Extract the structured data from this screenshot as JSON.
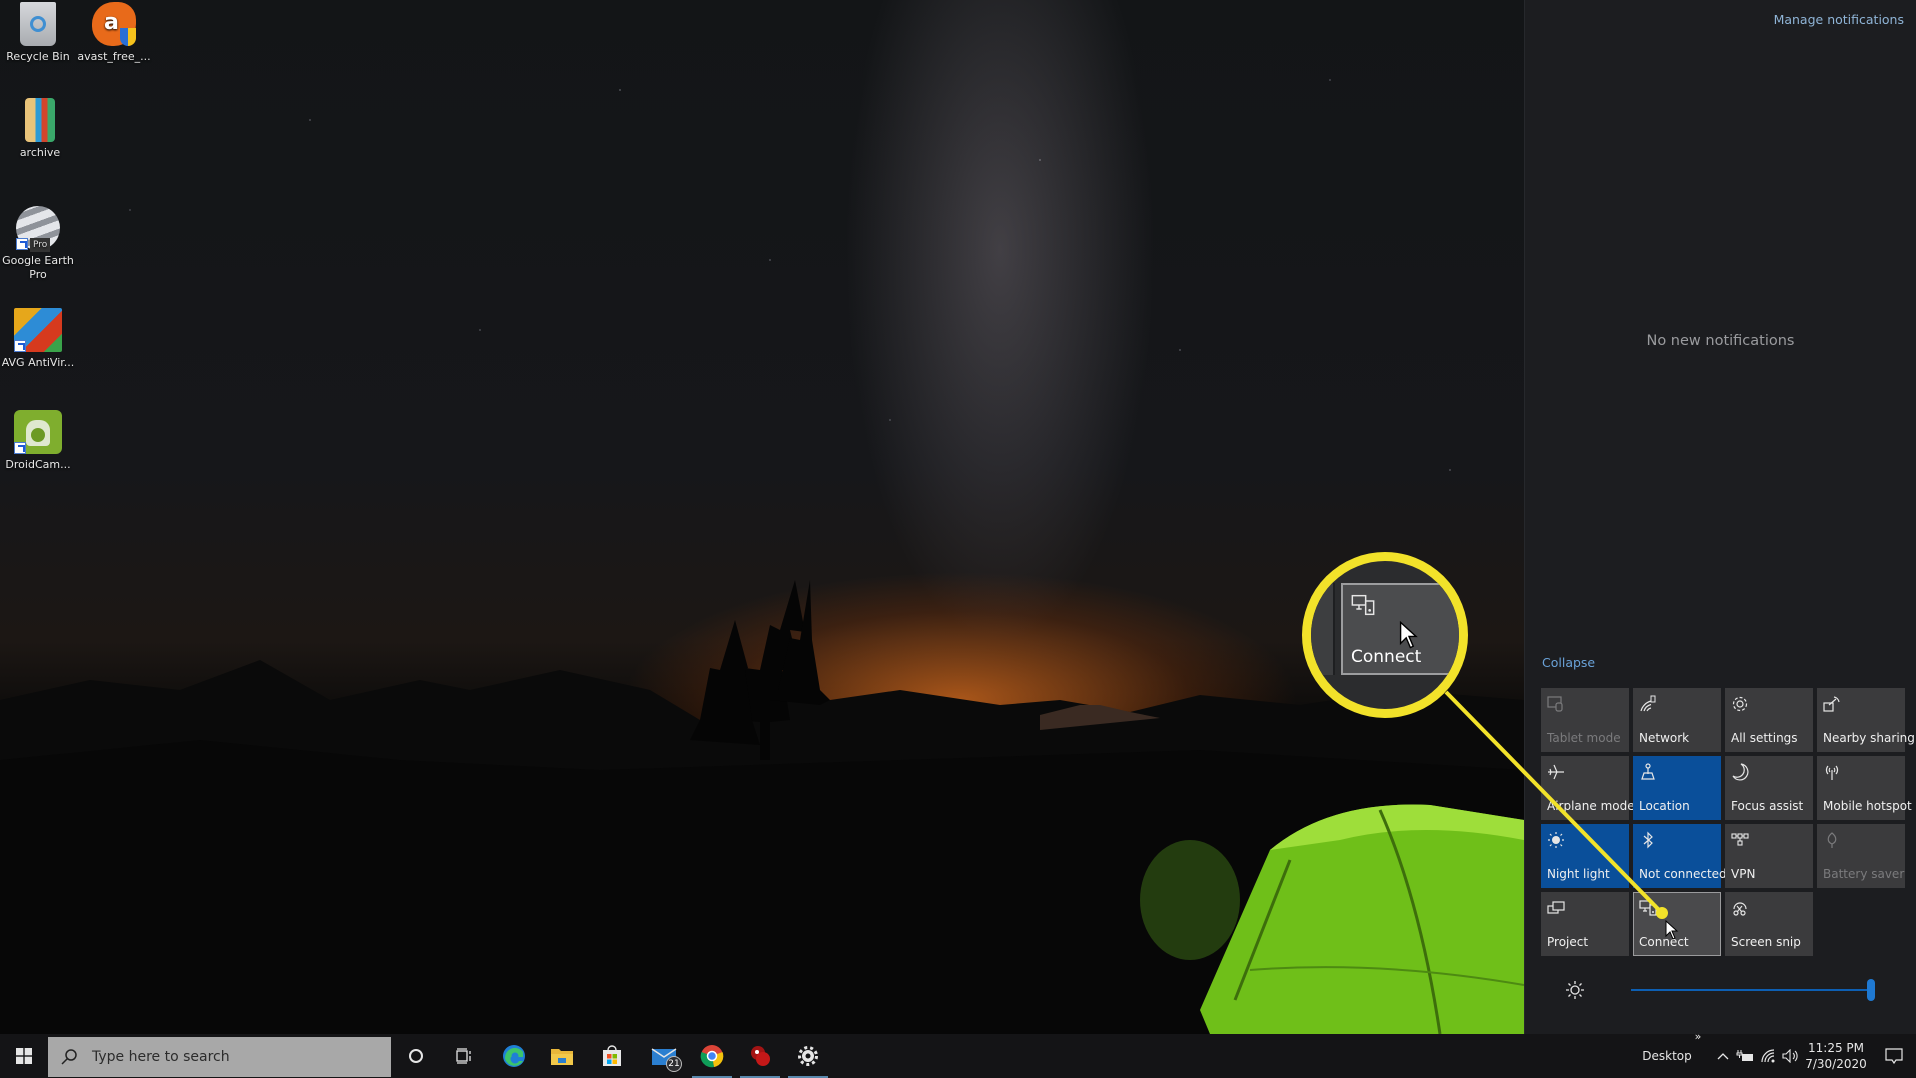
{
  "desktop": {
    "icons": [
      {
        "label": "Recycle Bin",
        "icon": "recycle-bin-icon"
      },
      {
        "label": "avast_free_...",
        "icon": "avast-icon"
      },
      {
        "label": "archive",
        "icon": "archive-folder-icon"
      },
      {
        "label": "Google Earth Pro",
        "icon": "google-earth-icon",
        "badge": "Pro"
      },
      {
        "label": "AVG AntiVir...",
        "icon": "avg-antivirus-icon"
      },
      {
        "label": "DroidCam...",
        "icon": "droidcam-icon"
      }
    ]
  },
  "action_center": {
    "manage_notifications": "Manage notifications",
    "empty_message": "No new notifications",
    "collapse_label": "Collapse",
    "tiles": [
      {
        "label": "Tablet mode",
        "icon": "tablet-mode-icon",
        "state": "disabled"
      },
      {
        "label": "Network",
        "icon": "network-icon",
        "state": "off"
      },
      {
        "label": "All settings",
        "icon": "gear-icon",
        "state": "off"
      },
      {
        "label": "Nearby sharing",
        "icon": "nearby-sharing-icon",
        "state": "off"
      },
      {
        "label": "Airplane mode",
        "icon": "airplane-icon",
        "state": "off"
      },
      {
        "label": "Location",
        "icon": "location-icon",
        "state": "on"
      },
      {
        "label": "Focus assist",
        "icon": "moon-icon",
        "state": "off"
      },
      {
        "label": "Mobile hotspot",
        "icon": "hotspot-icon",
        "state": "off"
      },
      {
        "label": "Night light",
        "icon": "night-light-icon",
        "state": "on"
      },
      {
        "label": "Not connected",
        "icon": "bluetooth-icon",
        "state": "on"
      },
      {
        "label": "VPN",
        "icon": "vpn-icon",
        "state": "off"
      },
      {
        "label": "Battery saver",
        "icon": "battery-saver-icon",
        "state": "disabled"
      },
      {
        "label": "Project",
        "icon": "project-icon",
        "state": "off"
      },
      {
        "label": "Connect",
        "icon": "connect-icon",
        "state": "hover"
      },
      {
        "label": "Screen snip",
        "icon": "screen-snip-icon",
        "state": "off"
      }
    ],
    "brightness_percent": 100,
    "accent_color": "#0a4f9a"
  },
  "callout": {
    "label": "Connect",
    "color": "#f2e22a"
  },
  "taskbar": {
    "search_placeholder": "Type here to search",
    "apps": [
      {
        "name": "cortana",
        "icon": "cortana-icon"
      },
      {
        "name": "task-view",
        "icon": "task-view-icon"
      },
      {
        "name": "edge",
        "icon": "edge-icon"
      },
      {
        "name": "file-explorer",
        "icon": "folder-icon"
      },
      {
        "name": "microsoft-store",
        "icon": "store-icon"
      },
      {
        "name": "mail",
        "icon": "mail-icon",
        "badge": "21"
      },
      {
        "name": "chrome",
        "icon": "chrome-icon",
        "running": true
      },
      {
        "name": "app-red",
        "icon": "red-app-icon",
        "running": true
      },
      {
        "name": "settings",
        "icon": "gear-icon",
        "running": true
      }
    ],
    "tray": {
      "desktop_label": "Desktop",
      "overflow_glyph": "»",
      "time": "11:25 PM",
      "date": "7/30/2020"
    }
  }
}
